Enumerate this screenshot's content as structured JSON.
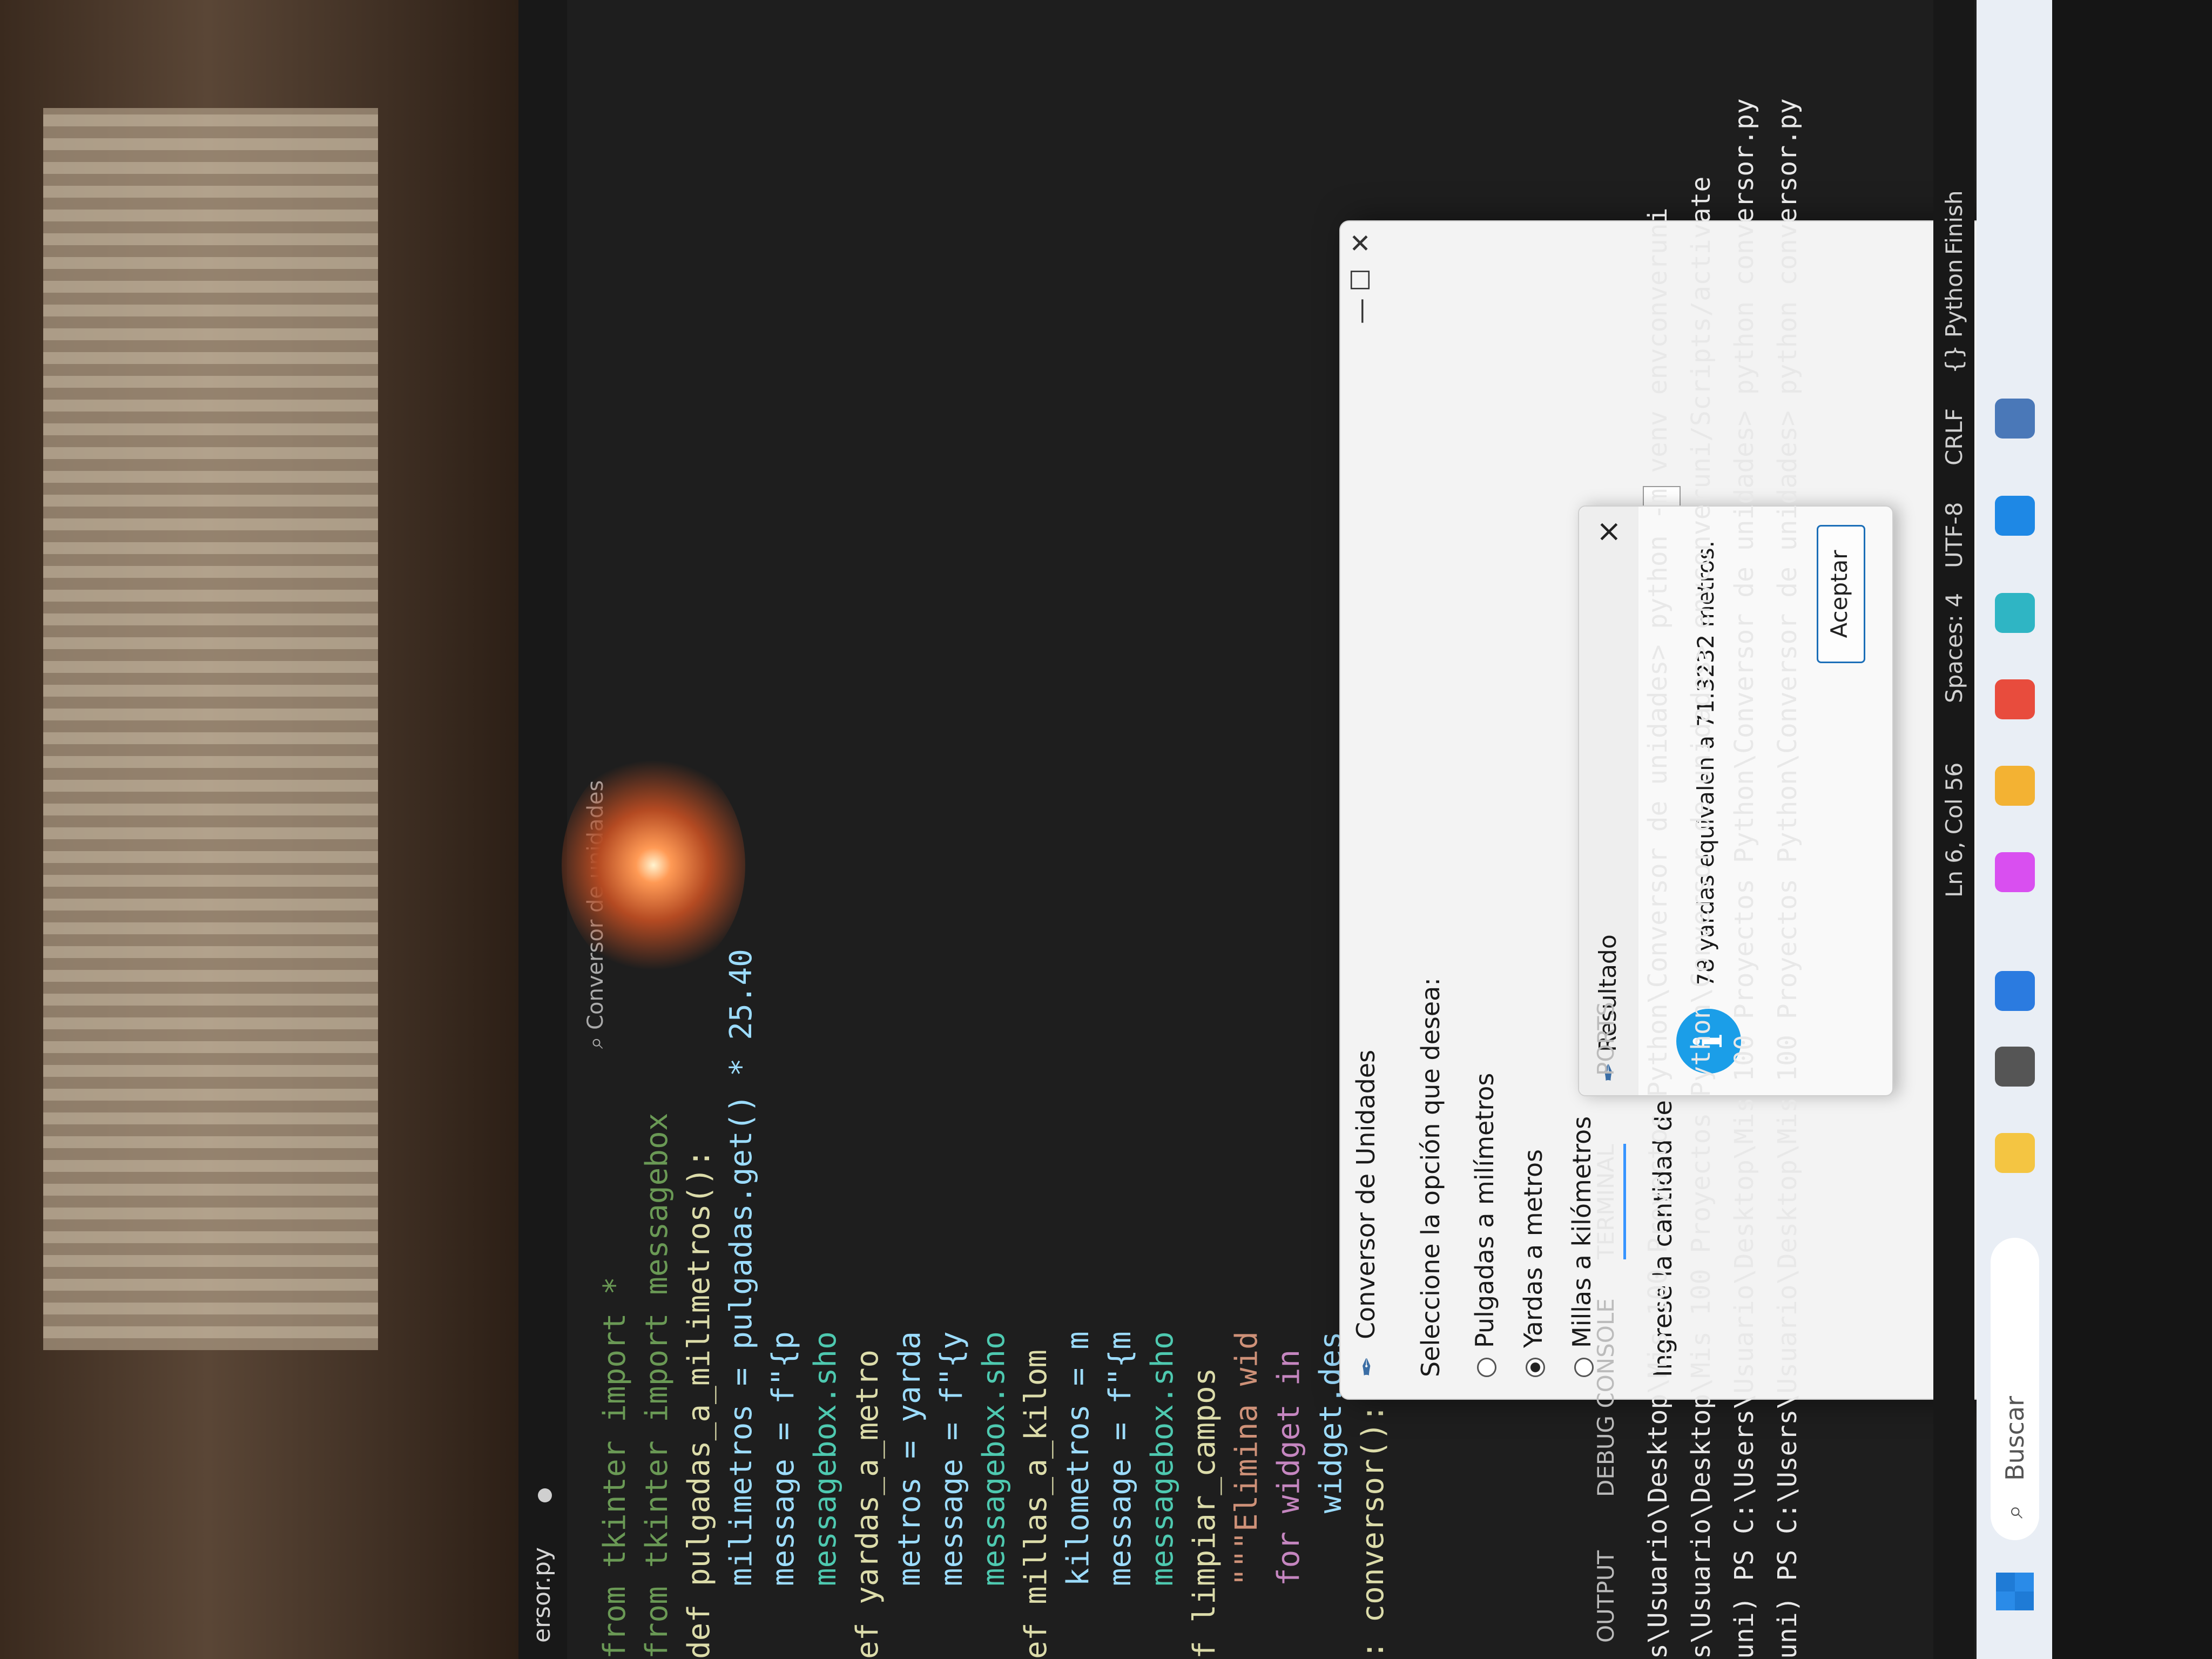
{
  "editor": {
    "tab_label": "ersor.py",
    "search_placeholder": "Conversor de unidades",
    "code_lines": [
      "from tkinter import *",
      "from tkinter import messagebox",
      "",
      "def pulgadas_a_milimetros():",
      "    milimetros = pulgadas.get() * 25.40",
      "    message = f\"{p",
      "    messagebox.sho",
      "",
      "ef yardas_a_metro",
      "    metros = yarda",
      "    message = f\"{y",
      "    messagebox.sho",
      "",
      "ef millas_a_kilom",
      "    kilometros = m",
      "    message = f\"{m",
      "    messagebox.sho",
      "",
      "f limpiar_campos",
      "    \"\"\"Elimina wid",
      "    for widget in",
      "        widget.des",
      "",
      ": conversor():"
    ]
  },
  "dialog": {
    "title": "Conversor de Unidades",
    "prompt": "Seleccione la opción que desea:",
    "options": [
      {
        "label": "Pulgadas a milímetros",
        "selected": false
      },
      {
        "label": "Yardas a metros",
        "selected": true
      },
      {
        "label": "Millas a kilómetros",
        "selected": false
      }
    ],
    "amount_label": "Ingrese la cantidad de yardas a convertir:",
    "amount_value": "78"
  },
  "messagebox": {
    "title": "Resultado",
    "icon": "info-icon",
    "text": "78 yardas equivalen a 71.3232 metros.",
    "ok_label": "Aceptar"
  },
  "panel": {
    "tabs": [
      "OUTPUT",
      "DEBUG CONSOLE",
      "TERMINAL",
      "PORTS"
    ],
    "active_tab": "TERMINAL"
  },
  "terminal": {
    "lines": [
      "s\\Usuario\\Desktop\\Mis 100 Proyectos Python\\Conversor de unidades> python -m venv envconveruni",
      "s\\Usuario\\Desktop\\Mis 100 Proyectos Python\\Conversor de unidades> envconveruni/Scripts/activate",
      "uni) PS C:\\Users\\Usuario\\Desktop\\Mis 100 Proyectos Python\\Conversor de unidades> python conversor.py",
      "uni) PS C:\\Users\\Usuario\\Desktop\\Mis 100 Proyectos Python\\Conversor de unidades> python conversor.py"
    ]
  },
  "statusbar": {
    "position": "Ln 6, Col 56",
    "spaces": "Spaces: 4",
    "encoding": "UTF-8",
    "eol": "CRLF",
    "language": "{} Python",
    "finish": "Finish"
  },
  "taskbar": {
    "search_label": "Buscar"
  },
  "colors": {
    "accent": "#3794ff",
    "info": "#1b9ee8",
    "terminal_cmd": "#e5c07b"
  }
}
